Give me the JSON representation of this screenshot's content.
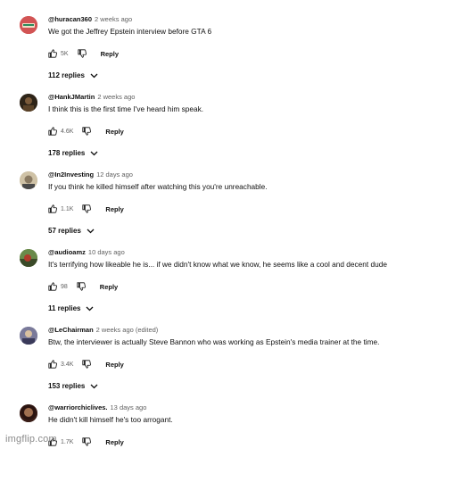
{
  "comments": [
    {
      "handle": "@huracan360",
      "time": "2 weeks ago",
      "text": "We got the Jeffrey Epstein interview before GTA 6",
      "likes": "5K",
      "reply_label": "Reply",
      "replies": "112 replies",
      "avatar_color": "#c94a4a"
    },
    {
      "handle": "@HankJMartin",
      "time": "2 weeks ago",
      "text": "I think this is the first time I've heard him speak.",
      "likes": "4.6K",
      "reply_label": "Reply",
      "replies": "178 replies",
      "avatar_color": "#3a2a1a"
    },
    {
      "handle": "@In2Investing",
      "time": "12 days ago",
      "text": "If you think he killed himself after watching this you're unreachable.",
      "likes": "1.1K",
      "reply_label": "Reply",
      "replies": "57 replies",
      "avatar_color": "#c8b89a"
    },
    {
      "handle": "@audioamz",
      "time": "10 days ago",
      "text": "It's terrifying how likeable he is... if we didn't know what we know, he seems like a cool and decent dude",
      "likes": "98",
      "reply_label": "Reply",
      "replies": "11 replies",
      "avatar_color": "#5a7a3a"
    },
    {
      "handle": "@LeChairman",
      "time": "2 weeks ago (edited)",
      "text": "Btw, the interviewer is actually Steve Bannon who was working as Epstein's media trainer at the time.",
      "likes": "3.4K",
      "reply_label": "Reply",
      "replies": "153 replies",
      "avatar_color": "#6a6a8a"
    },
    {
      "handle": "@warriorchiclives.",
      "time": "13 days ago",
      "text": "He didn't kill himself he's too arrogant.",
      "likes": "1.7K",
      "reply_label": "Reply",
      "replies": "",
      "avatar_color": "#4a2a22"
    }
  ],
  "watermark": "imgflip.com",
  "icons": {
    "like": "thumbs-up-icon",
    "dislike": "thumbs-down-icon",
    "expand": "chevron-down-icon"
  }
}
